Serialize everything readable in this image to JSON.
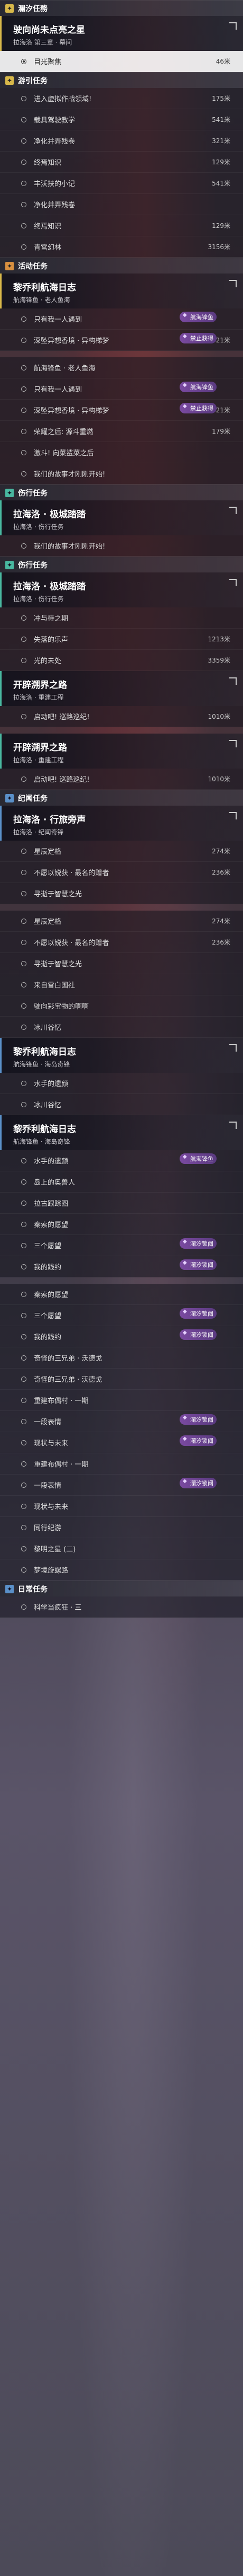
{
  "sections": [
    {
      "type": "section",
      "color": "yellow",
      "icon": "star-icon",
      "label": "瀾汐任務"
    },
    {
      "type": "quest",
      "color": "yellow",
      "title": "驶向尚未点亮之星",
      "subtitle": "拉海洛 第三章 · 幕间"
    },
    {
      "type": "row",
      "label": "目光聚焦",
      "dist": "46米",
      "sel": true
    },
    {
      "type": "section",
      "color": "yellow",
      "icon": "map-icon",
      "label": "游引任务"
    },
    {
      "type": "row",
      "label": "进入虚拟作战领域!",
      "dist": "175米"
    },
    {
      "type": "row",
      "label": "载具驾驶教学",
      "dist": "541米"
    },
    {
      "type": "row",
      "label": "净化并弄残卷",
      "dist": "321米"
    },
    {
      "type": "row",
      "label": "终焉知识",
      "dist": "129米"
    },
    {
      "type": "row",
      "label": "丰沃扶的小记",
      "dist": "541米"
    },
    {
      "type": "row",
      "label": "净化并弄残卷",
      "dist": ""
    },
    {
      "type": "row",
      "label": "终焉知识",
      "dist": "129米"
    },
    {
      "type": "row",
      "label": "青宫幻林",
      "dist": "3156米"
    },
    {
      "type": "section",
      "color": "orange",
      "icon": "book-icon",
      "label": "活动任务"
    },
    {
      "type": "quest",
      "color": "yellow",
      "title": "黎乔利航海日志",
      "subtitle": "航海锋鱼 · 老人鱼海"
    },
    {
      "type": "row",
      "label": "只有我一人遇到",
      "dist": "",
      "badge": "航海锋鱼"
    },
    {
      "type": "row",
      "label": "深坠异想香境 · 异构梯梦",
      "dist": "321米",
      "badge": "禁止获得"
    },
    {
      "type": "spacer"
    },
    {
      "type": "row",
      "label": "航海锋鱼 · 老人鱼海",
      "dist": ""
    },
    {
      "type": "row",
      "label": "只有我一人遇到",
      "dist": "",
      "badge": "航海锋鱼"
    },
    {
      "type": "row",
      "label": "深坠异想香境 · 异构梯梦",
      "dist": "321米",
      "badge": "禁止获得"
    },
    {
      "type": "row",
      "label": "荣耀之后: 源斗重燃",
      "dist": "179米"
    },
    {
      "type": "row",
      "label": "激斗! 向菜鲨菜之后",
      "dist": ""
    },
    {
      "type": "row",
      "label": "我们的故事才刚刚开始!",
      "dist": ""
    },
    {
      "type": "section",
      "color": "teal",
      "icon": "pin-icon",
      "label": "伤行任务"
    },
    {
      "type": "quest",
      "color": "teal",
      "title": "拉海洛 · 极城踏踏",
      "subtitle": "拉海洛 · 伤行任务"
    },
    {
      "type": "row",
      "label": "我们的故事才刚刚开始!",
      "dist": ""
    },
    {
      "type": "section",
      "color": "teal",
      "icon": "pin-icon",
      "label": "伤行任务"
    },
    {
      "type": "quest",
      "color": "teal",
      "title": "拉海洛 · 极城踏踏",
      "subtitle": "拉海洛 · 伤行任务"
    },
    {
      "type": "row",
      "label": "冲与待之期",
      "dist": ""
    },
    {
      "type": "row",
      "label": "失落的乐声",
      "dist": "1213米"
    },
    {
      "type": "row",
      "label": "光的未处",
      "dist": "3359米"
    },
    {
      "type": "quest",
      "color": "teal",
      "title": "开辟溯界之路",
      "subtitle": "拉海洛 · 重建工程"
    },
    {
      "type": "row",
      "label": "启动吧! 巡路巡纪!",
      "dist": "1010米"
    },
    {
      "type": "spacer"
    },
    {
      "type": "quest",
      "color": "teal",
      "title": "开辟溯界之路",
      "subtitle": "拉海洛 · 重建工程"
    },
    {
      "type": "row",
      "label": "启动吧! 巡路巡纪!",
      "dist": "1010米"
    },
    {
      "type": "section",
      "color": "blue",
      "icon": "flag-icon",
      "label": "纪闻任务"
    },
    {
      "type": "quest",
      "color": "blue",
      "title": "拉海洛 · 行旅旁声",
      "subtitle": "拉海洛 · 纪闻奇锋"
    },
    {
      "type": "row",
      "label": "星辰定格",
      "dist": "274米"
    },
    {
      "type": "row",
      "label": "不愿以锐获 · 最名的赠者",
      "dist": "236米"
    },
    {
      "type": "row",
      "label": "寻逝于智慧之光",
      "dist": ""
    },
    {
      "type": "spacer"
    },
    {
      "type": "row",
      "label": "星辰定格",
      "dist": "274米"
    },
    {
      "type": "row",
      "label": "不愿以锐获 · 最名的赠者",
      "dist": "236米"
    },
    {
      "type": "row",
      "label": "寻逝于智慧之光",
      "dist": ""
    },
    {
      "type": "row",
      "label": "来自雪白国社",
      "dist": ""
    },
    {
      "type": "row",
      "label": "驶向彩宝物的啊啊",
      "dist": ""
    },
    {
      "type": "row",
      "label": "冰川谷忆",
      "dist": ""
    },
    {
      "type": "quest",
      "color": "blue",
      "title": "黎乔利航海日志",
      "subtitle": "航海锋鱼 · 海岛奇锋"
    },
    {
      "type": "row",
      "label": "水手的遗颜",
      "dist": ""
    },
    {
      "type": "row",
      "label": "冰川谷忆",
      "dist": ""
    },
    {
      "type": "quest",
      "color": "blue",
      "title": "黎乔利航海日志",
      "subtitle": "航海锋鱼 · 海岛奇锋"
    },
    {
      "type": "row",
      "label": "水手的遗颜",
      "dist": "",
      "badge": "航海锋鱼"
    },
    {
      "type": "row",
      "label": "岛上的奥兽人",
      "dist": ""
    },
    {
      "type": "row",
      "label": "拉古跟踪图",
      "dist": ""
    },
    {
      "type": "row",
      "label": "秦索的愿望",
      "dist": ""
    },
    {
      "type": "row",
      "label": "三个愿望",
      "dist": "",
      "badge": "瀾汐锁阈"
    },
    {
      "type": "row",
      "label": "我的践约",
      "dist": "",
      "badge": "瀾汐锁阈"
    },
    {
      "type": "spacer"
    },
    {
      "type": "row",
      "label": "秦索的愿望",
      "dist": ""
    },
    {
      "type": "row",
      "label": "三个愿望",
      "dist": "",
      "badge": "瀾汐锁阈"
    },
    {
      "type": "row",
      "label": "我的践约",
      "dist": "",
      "badge": "瀾汐锁阈"
    },
    {
      "type": "row",
      "label": "奇怪的三兄弟 · 沃德戈",
      "dist": ""
    },
    {
      "type": "row",
      "label": "奇怪的三兄弟 · 沃德戈",
      "dist": ""
    },
    {
      "type": "row",
      "label": "重建布偶村 · 一期",
      "dist": ""
    },
    {
      "type": "row",
      "label": "一段表情",
      "dist": "",
      "badge": "瀾汐锁阈"
    },
    {
      "type": "row",
      "label": "现状与未来",
      "dist": "",
      "badge": "瀾汐锁阈"
    },
    {
      "type": "row",
      "label": "重建布偶村 · 一期",
      "dist": ""
    },
    {
      "type": "row",
      "label": "一段表情",
      "dist": "",
      "badge": "瀾汐锁阈"
    },
    {
      "type": "row",
      "label": "现状与未来",
      "dist": ""
    },
    {
      "type": "row",
      "label": "同行纪游",
      "dist": ""
    },
    {
      "type": "row",
      "label": "黎明之星 (二)",
      "dist": ""
    },
    {
      "type": "row",
      "label": "梦境旋螺路",
      "dist": ""
    },
    {
      "type": "section",
      "color": "blue",
      "icon": "flag-icon",
      "label": "日常任务"
    },
    {
      "type": "row",
      "label": "科学当疯狂 · 三",
      "dist": ""
    }
  ]
}
